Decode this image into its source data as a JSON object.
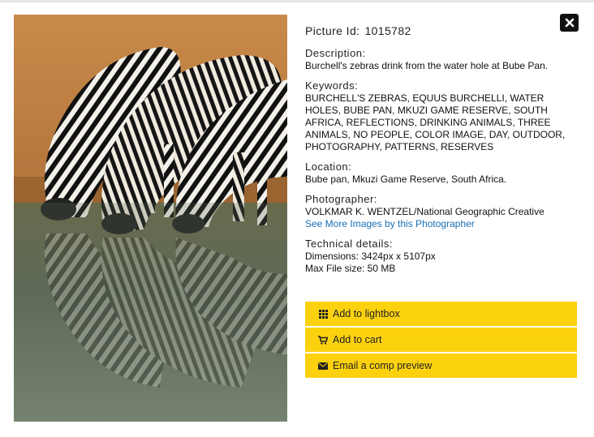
{
  "picture": {
    "id_label": "Picture Id:",
    "id_value": "1015782"
  },
  "description": {
    "title": "Description:",
    "text": "Burchell's zebras drink from the water hole at Bube Pan."
  },
  "keywords": {
    "title": "Keywords:",
    "text": "BURCHELL'S ZEBRAS, EQUUS BURCHELLI, WATER HOLES, BUBE PAN, MKUZI GAME RESERVE, SOUTH AFRICA, REFLECTIONS, DRINKING ANIMALS, THREE ANIMALS, NO PEOPLE, COLOR IMAGE, DAY, OUTDOOR, PHOTOGRAPHY, PATTERNS, RESERVES"
  },
  "location": {
    "title": "Location:",
    "text": "Bube pan, Mkuzi Game Reserve, South Africa."
  },
  "photographer": {
    "title": "Photographer:",
    "name": "VOLKMAR K. WENTZEL/National Geographic Creative",
    "link": "See More Images by this Photographer"
  },
  "technical": {
    "title": "Technical details:",
    "dimensions": "Dimensions: 3424px x 5107px",
    "max_size": "Max File size: 50 MB"
  },
  "actions": [
    {
      "label": "Add to lightbox",
      "icon": "grid-icon"
    },
    {
      "label": "Add to cart",
      "icon": "cart-icon"
    },
    {
      "label": "Email a comp preview",
      "icon": "envelope-icon"
    }
  ],
  "close_icon": "close-icon",
  "colors": {
    "button_bg": "#fcd20f",
    "link": "#1a6fb3",
    "close_bg": "#111111"
  }
}
